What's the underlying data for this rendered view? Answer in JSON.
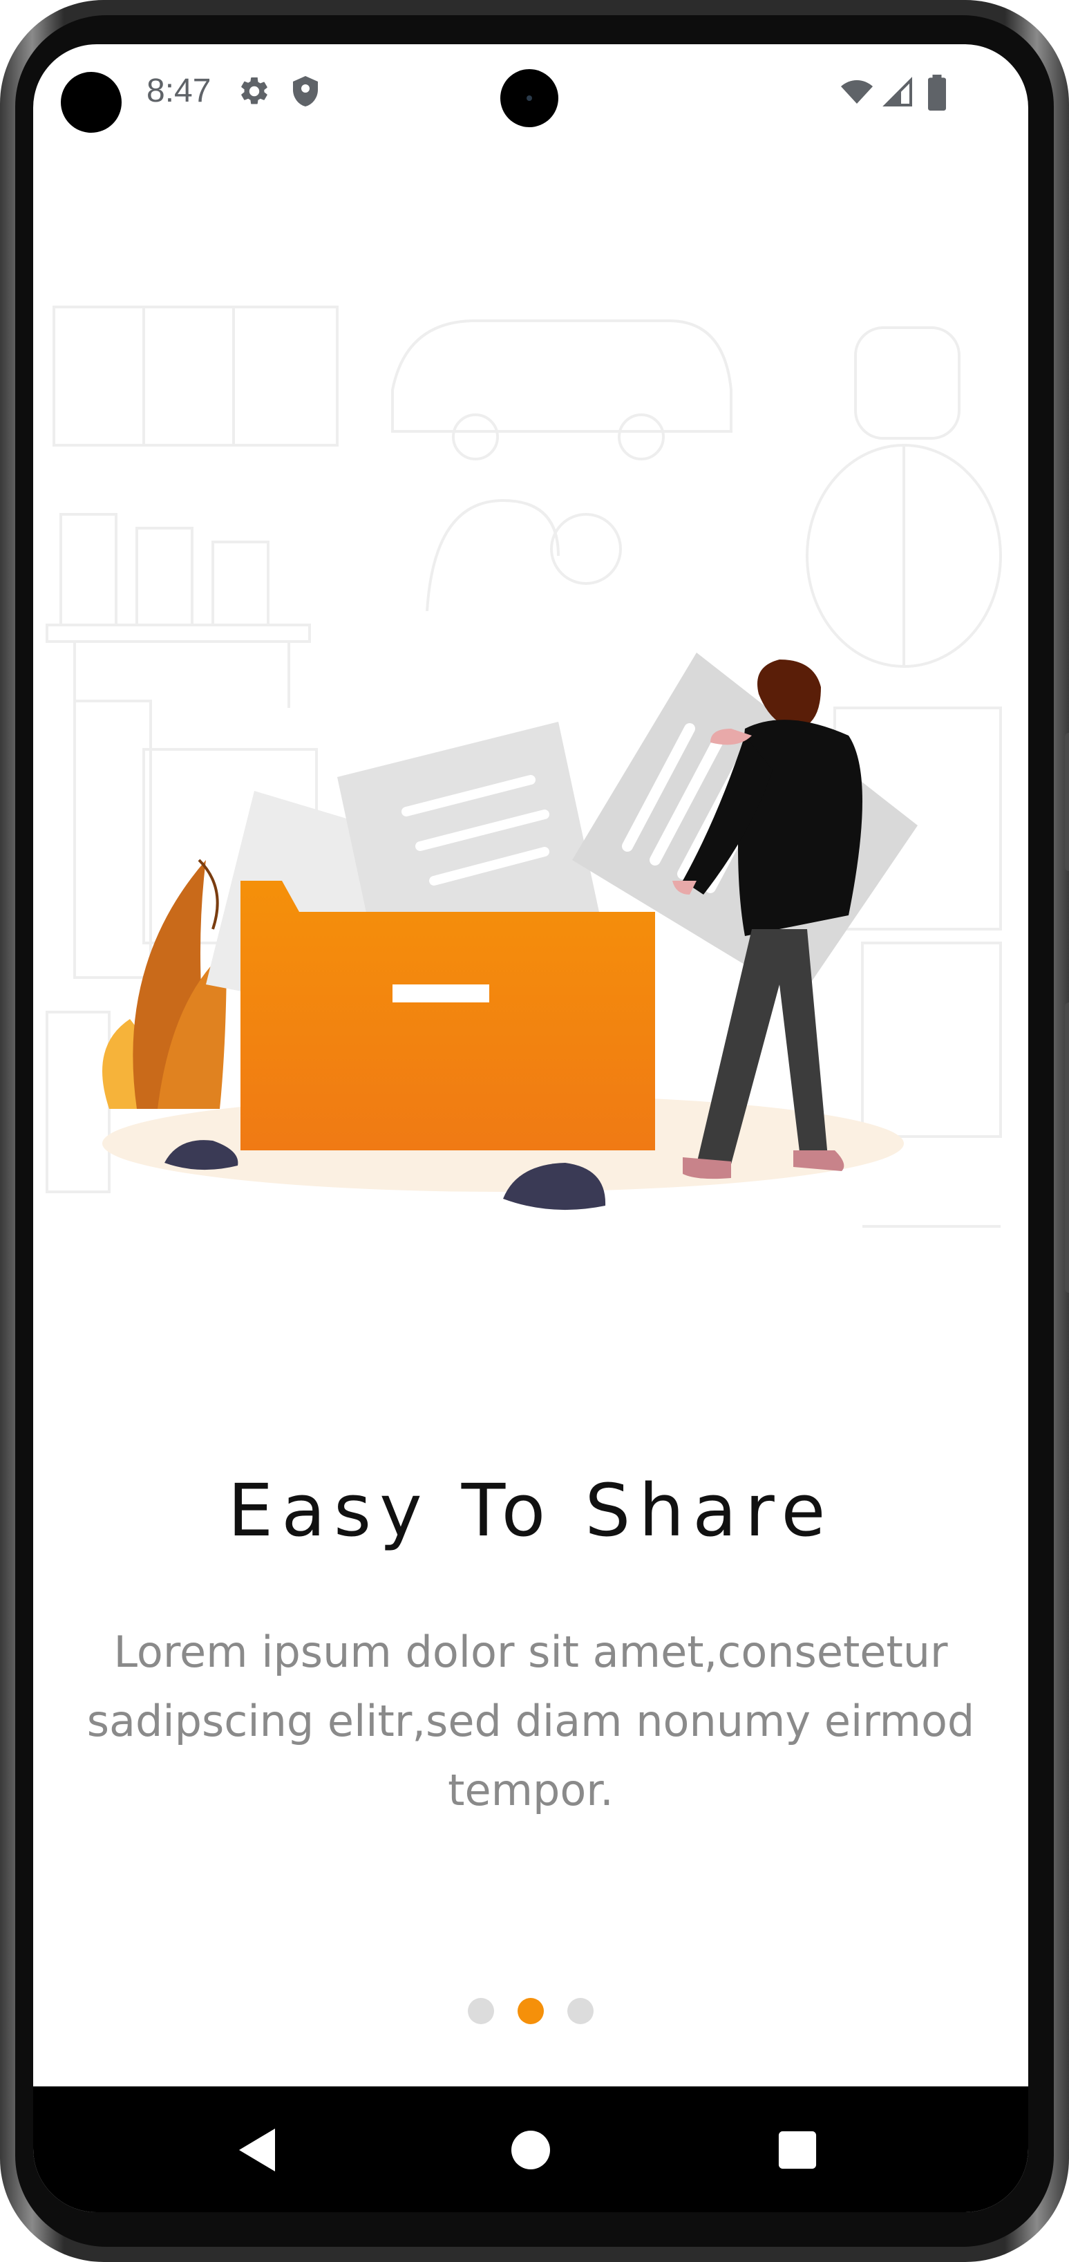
{
  "status_bar": {
    "time": "8:47",
    "icons": [
      "settings-icon",
      "shield-icon",
      "wifi-icon",
      "signal-icon",
      "battery-icon"
    ]
  },
  "onboarding": {
    "title": "Easy To Share",
    "description": "Lorem ipsum dolor sit amet,consetetur sadipscing elitr,sed diam nonumy eirmod tempor.",
    "page_count": 3,
    "active_page": 2
  },
  "colors": {
    "accent": "#F5900A",
    "folder": "#F28A12",
    "inactive_dot": "#DCDCDC",
    "title": "#111111",
    "description": "#8A8A8A"
  },
  "nav_bar": {
    "buttons": [
      "back-icon",
      "home-icon",
      "recents-icon"
    ]
  }
}
